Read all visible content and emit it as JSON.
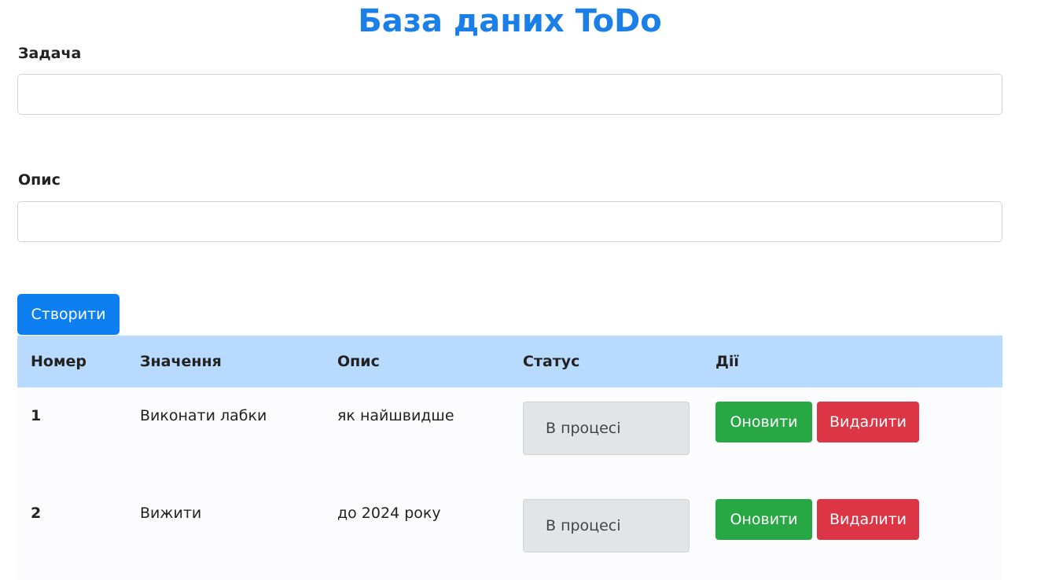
{
  "header": {
    "title": "База даних ToDo"
  },
  "form": {
    "task_label": "Задача",
    "task_value": "",
    "description_label": "Опис",
    "description_value": "",
    "create_label": "Створити"
  },
  "table": {
    "columns": [
      "Номер",
      "Значення",
      "Опис",
      "Статус",
      "Дії"
    ],
    "rows": [
      {
        "number": "1",
        "value": "Виконати лабки",
        "description": "як найшвидше",
        "status": "В процесі",
        "update_label": "Оновити",
        "delete_label": "Видалити"
      },
      {
        "number": "2",
        "value": "Вижити",
        "description": "до 2024 року",
        "status": "В процесі",
        "update_label": "Оновити",
        "delete_label": "Видалити"
      }
    ]
  },
  "colors": {
    "title": "#1a7fe6",
    "primary": "#0d7ff0",
    "table_header": "#b8daff",
    "success": "#28a745",
    "danger": "#dc3545"
  }
}
